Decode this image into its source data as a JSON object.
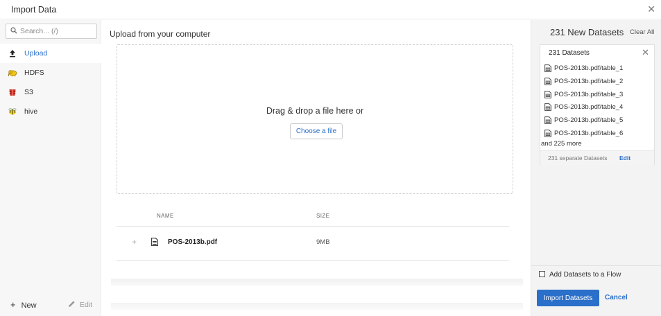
{
  "window": {
    "title": "Import Data",
    "close_icon": "close-icon"
  },
  "sidebar": {
    "search_placeholder": "Search... (/)",
    "items": [
      {
        "label": "Upload",
        "icon": "upload-icon",
        "active": true
      },
      {
        "label": "HDFS",
        "icon": "hdfs-elephant-icon",
        "active": false
      },
      {
        "label": "S3",
        "icon": "s3-bucket-icon",
        "active": false
      },
      {
        "label": "hive",
        "icon": "hive-bee-icon",
        "active": false
      }
    ],
    "new_label": "New",
    "edit_label": "Edit"
  },
  "main": {
    "title": "Upload from your computer",
    "drop_text": "Drag & drop a file here or",
    "choose_label": "Choose a file",
    "columns": {
      "name": "NAME",
      "size": "SIZE"
    },
    "files": [
      {
        "name": "POS-2013b.pdf",
        "size": "9MB"
      }
    ]
  },
  "right": {
    "title": "231 New Datasets",
    "clear_label": "Clear All",
    "card": {
      "title": "231 Datasets",
      "items": [
        "POS-2013b.pdf/table_1",
        "POS-2013b.pdf/table_2",
        "POS-2013b.pdf/table_3",
        "POS-2013b.pdf/table_4",
        "POS-2013b.pdf/table_5",
        "POS-2013b.pdf/table_6"
      ],
      "more_text": "and 225 more",
      "footer_text": "231 separate Datasets",
      "edit_label": "Edit"
    },
    "flow_label": "Add Datasets to a Flow",
    "flow_checked": false,
    "import_label": "Import Datasets",
    "cancel_label": "Cancel"
  },
  "colors": {
    "accent": "#2a6fc9",
    "sidebar_bg": "#f7f7f7",
    "panel_bg": "#f3f3f3"
  }
}
